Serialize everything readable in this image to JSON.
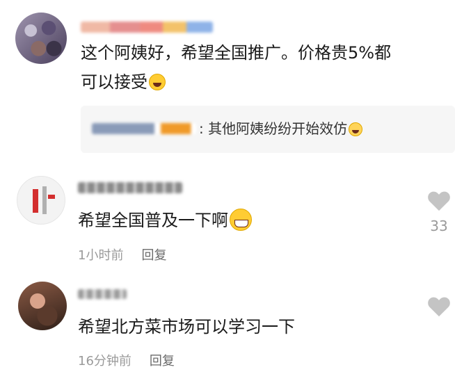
{
  "comments": [
    {
      "username": "",
      "text_line1": "这个阿姨好，希望全国推广。价格贵5%都",
      "text_line2": "可以接受",
      "reply": {
        "text": ": 其他阿姨纷纷开始效仿"
      }
    },
    {
      "username": "",
      "text": "希望全国普及一下啊",
      "time": "1小时前",
      "reply_label": "回复",
      "like_count": "33"
    },
    {
      "username": "",
      "text": "希望北方菜市场可以学习一下",
      "time": "16分钟前",
      "reply_label": "回复"
    }
  ],
  "icons": {
    "like": "heart-icon",
    "emoji_laugh": "laughing-emoji-icon",
    "emoji_grin": "grinning-emoji-icon",
    "emoji_think": "thinking-emoji-icon"
  }
}
